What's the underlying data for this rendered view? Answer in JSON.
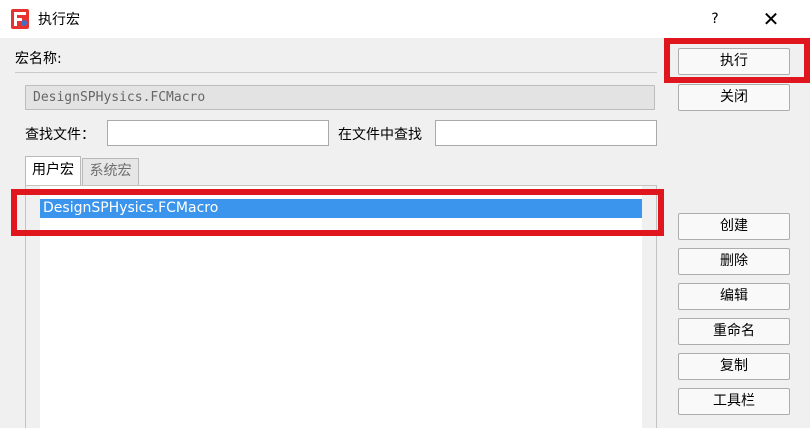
{
  "window": {
    "title": "执行宏",
    "help_label": "?",
    "close_label": "✕",
    "icon": "freecad-app-icon"
  },
  "form": {
    "macro_name_label": "宏名称:",
    "macro_name_value": "DesignSPHysics.FCMacro",
    "find_file_label": "查找文件：",
    "find_in_files_label": "在文件中查找",
    "find_file_value": "",
    "find_in_files_value": ""
  },
  "tabs": [
    {
      "label": "用户宏",
      "active": true
    },
    {
      "label": "系统宏",
      "active": false
    }
  ],
  "macro_list": [
    {
      "name": "DesignSPHysics.FCMacro",
      "selected": true
    }
  ],
  "buttons": {
    "execute": "执行",
    "close": "关闭",
    "create": "创建",
    "delete": "删除",
    "edit": "编辑",
    "rename": "重命名",
    "duplicate": "复制",
    "toolbar": "工具栏"
  },
  "colors": {
    "highlight_box": "#e0161e",
    "selection": "#3c95ec"
  }
}
